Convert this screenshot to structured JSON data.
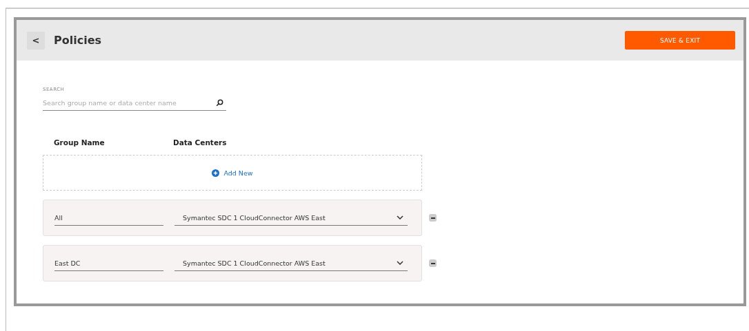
{
  "header": {
    "back": "<",
    "title": "Policies",
    "save_button": "SAVE & EXIT"
  },
  "search": {
    "label": "SEARCH",
    "placeholder": "Search group name or data center name"
  },
  "columns": [
    "Group Name",
    "Data Centers"
  ],
  "add_new": "Add New",
  "rows": [
    {
      "group": "All",
      "data_center": "Symantec SDC 1 CloudConnector AWS East"
    },
    {
      "group": "East DC",
      "data_center": "Symantec SDC 1 CloudConnector AWS East"
    }
  ]
}
